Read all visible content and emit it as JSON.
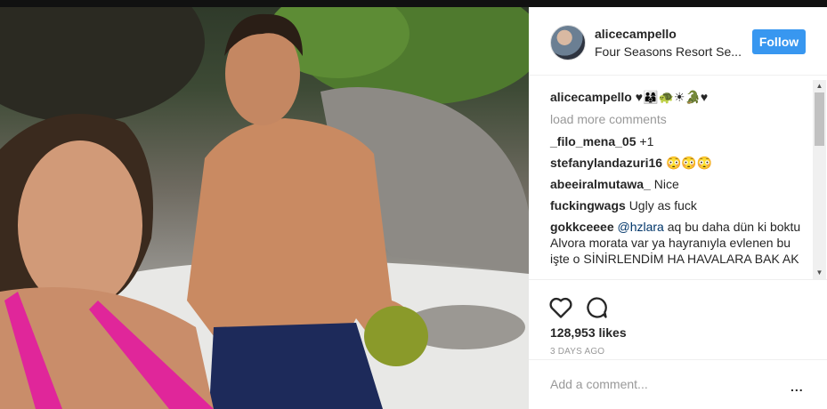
{
  "post": {
    "username": "alicecampello",
    "location": "Four Seasons Resort Se...",
    "follow_label": "Follow",
    "photo_icon": "beach-selfie-photo"
  },
  "comments": {
    "caption": {
      "user": "alicecampello",
      "text": "♥👨‍👩‍👦🐢☀🐊♥"
    },
    "load_more": "load more comments",
    "items": [
      {
        "user": "_filo_mena_05",
        "text": "+1"
      },
      {
        "user": "stefanylandazuri16",
        "text": "😳😳😳"
      },
      {
        "user": "abeeiralmutawa_",
        "text": "Nice"
      },
      {
        "user": "fuckingwags",
        "text": "Ugly as fuck"
      },
      {
        "user": "gokkceeee",
        "mention": "@hzlara",
        "text": "aq bu daha dün ki boktu Alvora morata var ya hayranıyla evlenen bu işte o SİNİRLENDİM HA HAVALARA BAK AK"
      }
    ]
  },
  "actions": {
    "like_icon": "heart-icon",
    "comment_icon": "comment-icon",
    "likes": "128,953 likes",
    "date": "3 DAYS AGO"
  },
  "add_comment": {
    "placeholder": "Add a comment...",
    "more_label": "..."
  }
}
